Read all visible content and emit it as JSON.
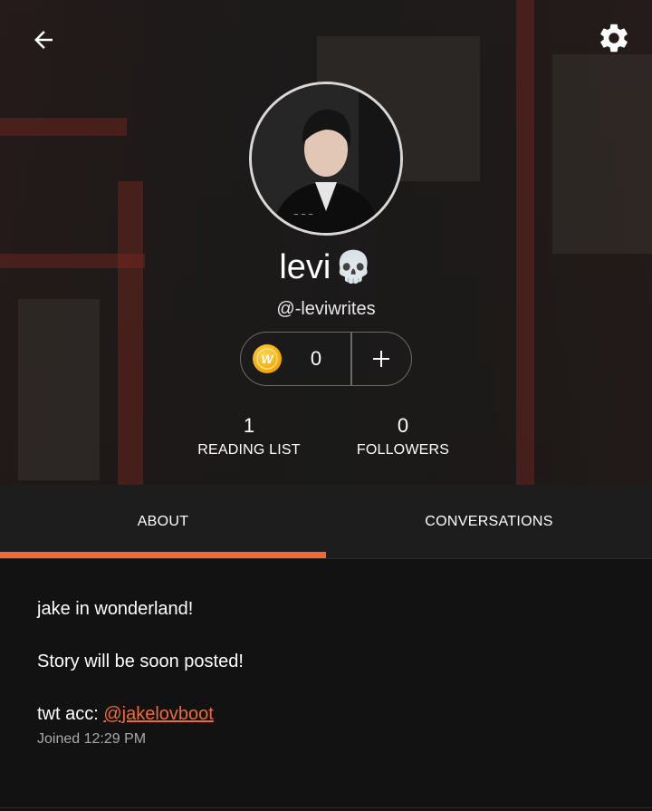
{
  "header": {
    "back_icon": "arrow-left-icon",
    "settings_icon": "gear-icon"
  },
  "profile": {
    "display_name": "levi",
    "name_emoji": "💀",
    "handle": "@-leviwrites",
    "avatar_icon": "profile-photo"
  },
  "coins": {
    "icon": "wattpad-coin-icon",
    "icon_letter": "W",
    "count": "0",
    "add_label": "+"
  },
  "stats": [
    {
      "value": "1",
      "label": "READING LIST"
    },
    {
      "value": "0",
      "label": "FOLLOWERS"
    }
  ],
  "tabs": [
    {
      "label": "ABOUT",
      "active": true
    },
    {
      "label": "CONVERSATIONS",
      "active": false
    }
  ],
  "about": {
    "line1": "jake in wonderland!",
    "line2": "Story will be soon posted!",
    "twt_prefix": "twt acc: ",
    "twt_link": "@jakelovboot",
    "joined": "Joined 12:29 PM"
  },
  "colors": {
    "accent": "#ee6a3a",
    "background": "#121212",
    "tab_bar": "#1d1d1d"
  }
}
